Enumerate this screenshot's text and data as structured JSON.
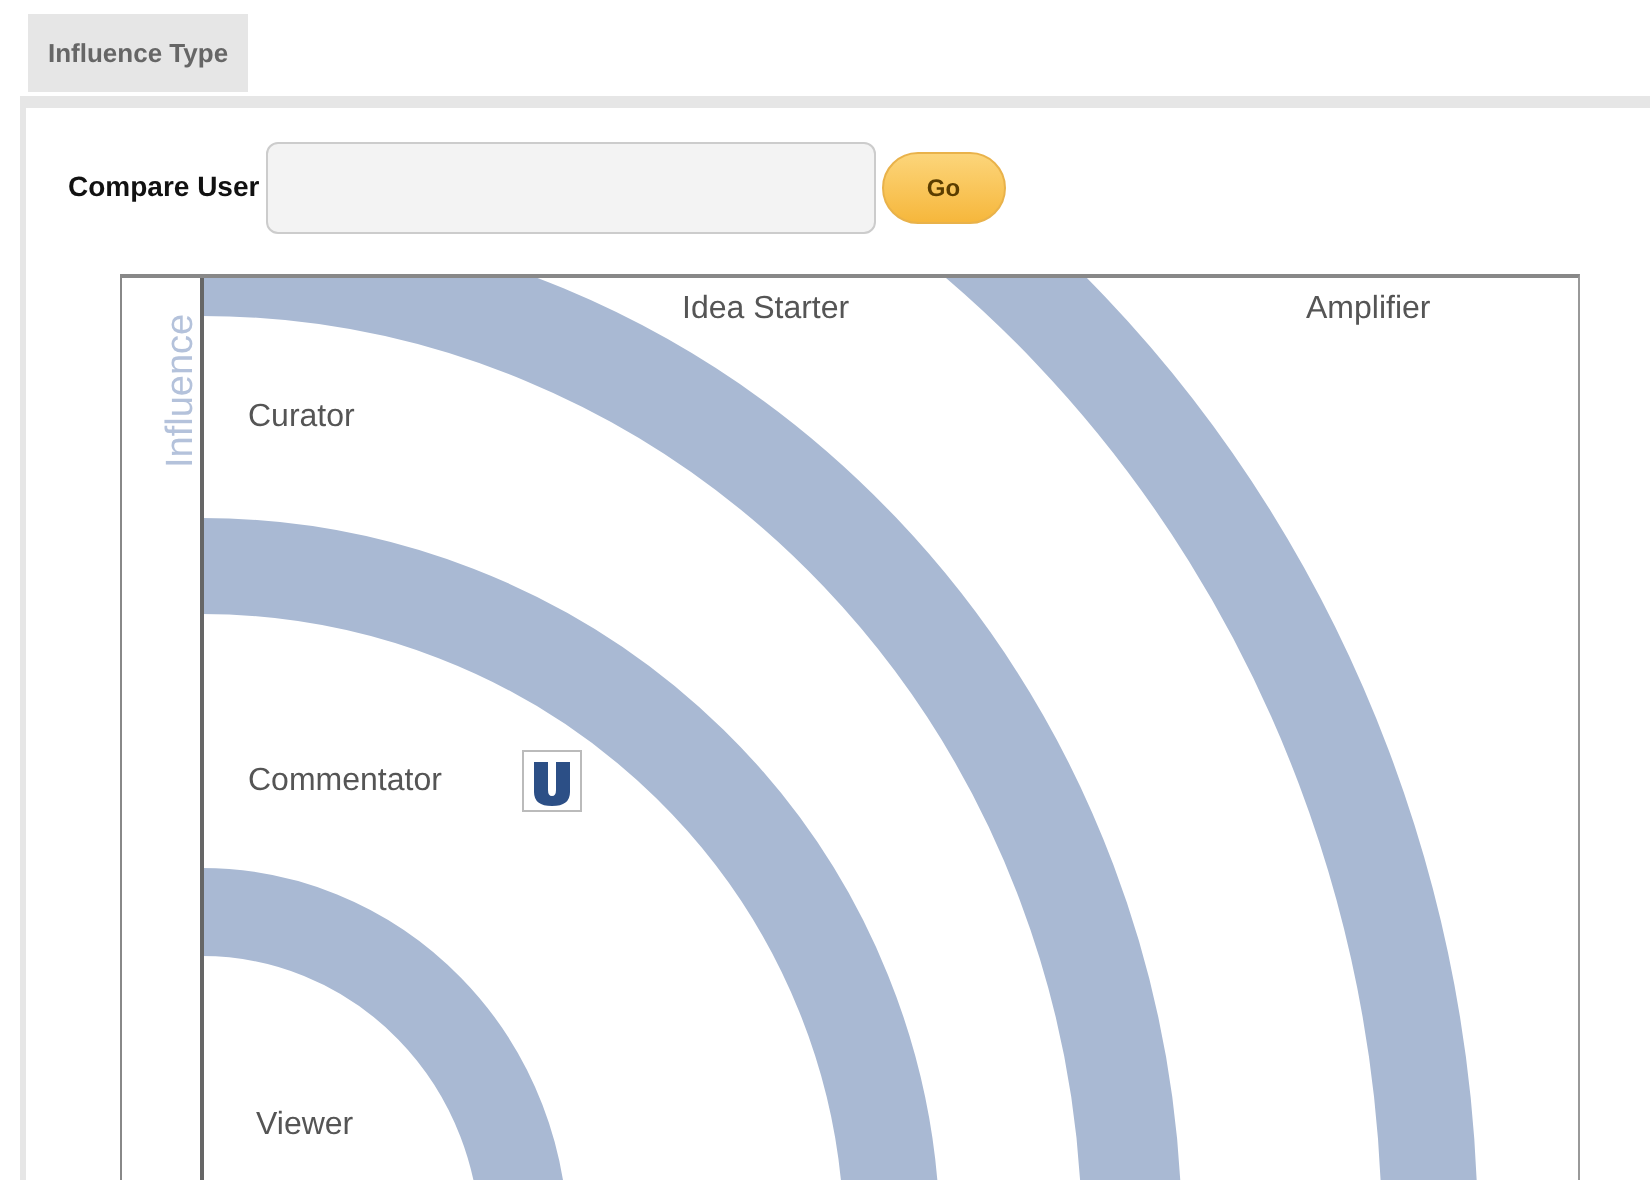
{
  "tabs": [
    {
      "label": "Influence Type",
      "selected": true
    }
  ],
  "compare": {
    "label": "Compare User",
    "button": "Go"
  },
  "chart": {
    "axis_label": "Influence",
    "column_labels": [
      "Idea Starter",
      "Amplifier"
    ],
    "row_labels": [
      "Curator",
      "Commentator",
      "Viewer"
    ]
  }
}
